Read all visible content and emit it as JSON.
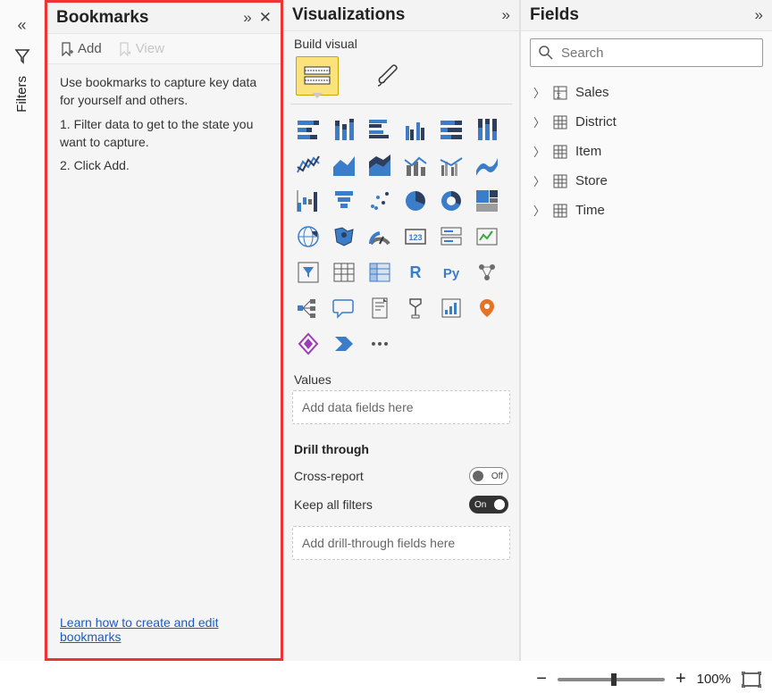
{
  "filters": {
    "label": "Filters",
    "filter_icon_name": "filter-icon"
  },
  "bookmarks": {
    "title": "Bookmarks",
    "add_label": "Add",
    "view_label": "View",
    "intro": "Use bookmarks to capture key data for yourself and others.",
    "step1": "1. Filter data to get to the state you want to capture.",
    "step2": "2. Click Add.",
    "help_link": "Learn how to create and edit bookmarks"
  },
  "visualizations": {
    "title": "Visualizations",
    "build_label": "Build visual",
    "values_label": "Values",
    "values_placeholder": "Add data fields here",
    "drill_title": "Drill through",
    "cross_report_label": "Cross-report",
    "cross_report_value": "Off",
    "keep_filters_label": "Keep all filters",
    "keep_filters_value": "On",
    "drill_placeholder": "Add drill-through fields here",
    "icons": [
      "stacked-bar",
      "stacked-column",
      "clustered-bar",
      "clustered-column",
      "100-stacked-bar",
      "100-stacked-column",
      "line",
      "area",
      "stacked-area",
      "line-stacked-column",
      "line-clustered-column",
      "ribbon",
      "waterfall",
      "funnel",
      "scatter",
      "pie",
      "donut",
      "treemap",
      "map",
      "filled-map",
      "gauge",
      "card",
      "multi-row-card",
      "kpi",
      "slicer",
      "table",
      "matrix",
      "r-visual",
      "python-visual",
      "key-influencers",
      "decomposition-tree",
      "qna",
      "paginated-report",
      "goals",
      "scorecard",
      "arcgis",
      "power-apps",
      "power-automate",
      "more"
    ]
  },
  "fields": {
    "title": "Fields",
    "search_placeholder": "Search",
    "tables": [
      {
        "name": "Sales",
        "icon": "sigma-table-icon"
      },
      {
        "name": "District",
        "icon": "table-icon"
      },
      {
        "name": "Item",
        "icon": "table-icon"
      },
      {
        "name": "Store",
        "icon": "table-icon"
      },
      {
        "name": "Time",
        "icon": "table-icon"
      }
    ]
  },
  "zoom": {
    "level": "100%"
  }
}
